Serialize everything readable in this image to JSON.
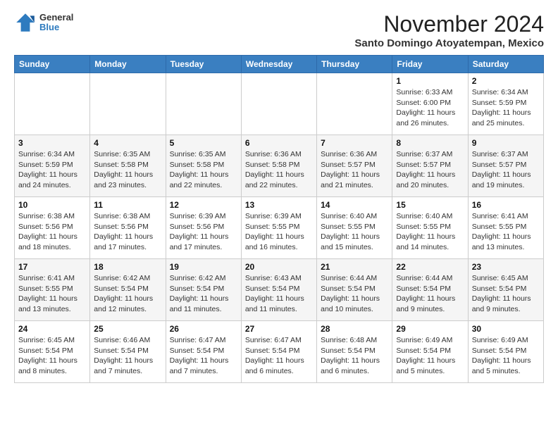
{
  "header": {
    "logo": {
      "line1": "General",
      "line2": "Blue"
    },
    "title": "November 2024",
    "subtitle": "Santo Domingo Atoyatempan, Mexico"
  },
  "weekdays": [
    "Sunday",
    "Monday",
    "Tuesday",
    "Wednesday",
    "Thursday",
    "Friday",
    "Saturday"
  ],
  "weeks": [
    [
      {
        "day": "",
        "info": ""
      },
      {
        "day": "",
        "info": ""
      },
      {
        "day": "",
        "info": ""
      },
      {
        "day": "",
        "info": ""
      },
      {
        "day": "",
        "info": ""
      },
      {
        "day": "1",
        "info": "Sunrise: 6:33 AM\nSunset: 6:00 PM\nDaylight: 11 hours and 26 minutes."
      },
      {
        "day": "2",
        "info": "Sunrise: 6:34 AM\nSunset: 5:59 PM\nDaylight: 11 hours and 25 minutes."
      }
    ],
    [
      {
        "day": "3",
        "info": "Sunrise: 6:34 AM\nSunset: 5:59 PM\nDaylight: 11 hours and 24 minutes."
      },
      {
        "day": "4",
        "info": "Sunrise: 6:35 AM\nSunset: 5:58 PM\nDaylight: 11 hours and 23 minutes."
      },
      {
        "day": "5",
        "info": "Sunrise: 6:35 AM\nSunset: 5:58 PM\nDaylight: 11 hours and 22 minutes."
      },
      {
        "day": "6",
        "info": "Sunrise: 6:36 AM\nSunset: 5:58 PM\nDaylight: 11 hours and 22 minutes."
      },
      {
        "day": "7",
        "info": "Sunrise: 6:36 AM\nSunset: 5:57 PM\nDaylight: 11 hours and 21 minutes."
      },
      {
        "day": "8",
        "info": "Sunrise: 6:37 AM\nSunset: 5:57 PM\nDaylight: 11 hours and 20 minutes."
      },
      {
        "day": "9",
        "info": "Sunrise: 6:37 AM\nSunset: 5:57 PM\nDaylight: 11 hours and 19 minutes."
      }
    ],
    [
      {
        "day": "10",
        "info": "Sunrise: 6:38 AM\nSunset: 5:56 PM\nDaylight: 11 hours and 18 minutes."
      },
      {
        "day": "11",
        "info": "Sunrise: 6:38 AM\nSunset: 5:56 PM\nDaylight: 11 hours and 17 minutes."
      },
      {
        "day": "12",
        "info": "Sunrise: 6:39 AM\nSunset: 5:56 PM\nDaylight: 11 hours and 17 minutes."
      },
      {
        "day": "13",
        "info": "Sunrise: 6:39 AM\nSunset: 5:55 PM\nDaylight: 11 hours and 16 minutes."
      },
      {
        "day": "14",
        "info": "Sunrise: 6:40 AM\nSunset: 5:55 PM\nDaylight: 11 hours and 15 minutes."
      },
      {
        "day": "15",
        "info": "Sunrise: 6:40 AM\nSunset: 5:55 PM\nDaylight: 11 hours and 14 minutes."
      },
      {
        "day": "16",
        "info": "Sunrise: 6:41 AM\nSunset: 5:55 PM\nDaylight: 11 hours and 13 minutes."
      }
    ],
    [
      {
        "day": "17",
        "info": "Sunrise: 6:41 AM\nSunset: 5:55 PM\nDaylight: 11 hours and 13 minutes."
      },
      {
        "day": "18",
        "info": "Sunrise: 6:42 AM\nSunset: 5:54 PM\nDaylight: 11 hours and 12 minutes."
      },
      {
        "day": "19",
        "info": "Sunrise: 6:42 AM\nSunset: 5:54 PM\nDaylight: 11 hours and 11 minutes."
      },
      {
        "day": "20",
        "info": "Sunrise: 6:43 AM\nSunset: 5:54 PM\nDaylight: 11 hours and 11 minutes."
      },
      {
        "day": "21",
        "info": "Sunrise: 6:44 AM\nSunset: 5:54 PM\nDaylight: 11 hours and 10 minutes."
      },
      {
        "day": "22",
        "info": "Sunrise: 6:44 AM\nSunset: 5:54 PM\nDaylight: 11 hours and 9 minutes."
      },
      {
        "day": "23",
        "info": "Sunrise: 6:45 AM\nSunset: 5:54 PM\nDaylight: 11 hours and 9 minutes."
      }
    ],
    [
      {
        "day": "24",
        "info": "Sunrise: 6:45 AM\nSunset: 5:54 PM\nDaylight: 11 hours and 8 minutes."
      },
      {
        "day": "25",
        "info": "Sunrise: 6:46 AM\nSunset: 5:54 PM\nDaylight: 11 hours and 7 minutes."
      },
      {
        "day": "26",
        "info": "Sunrise: 6:47 AM\nSunset: 5:54 PM\nDaylight: 11 hours and 7 minutes."
      },
      {
        "day": "27",
        "info": "Sunrise: 6:47 AM\nSunset: 5:54 PM\nDaylight: 11 hours and 6 minutes."
      },
      {
        "day": "28",
        "info": "Sunrise: 6:48 AM\nSunset: 5:54 PM\nDaylight: 11 hours and 6 minutes."
      },
      {
        "day": "29",
        "info": "Sunrise: 6:49 AM\nSunset: 5:54 PM\nDaylight: 11 hours and 5 minutes."
      },
      {
        "day": "30",
        "info": "Sunrise: 6:49 AM\nSunset: 5:54 PM\nDaylight: 11 hours and 5 minutes."
      }
    ]
  ]
}
